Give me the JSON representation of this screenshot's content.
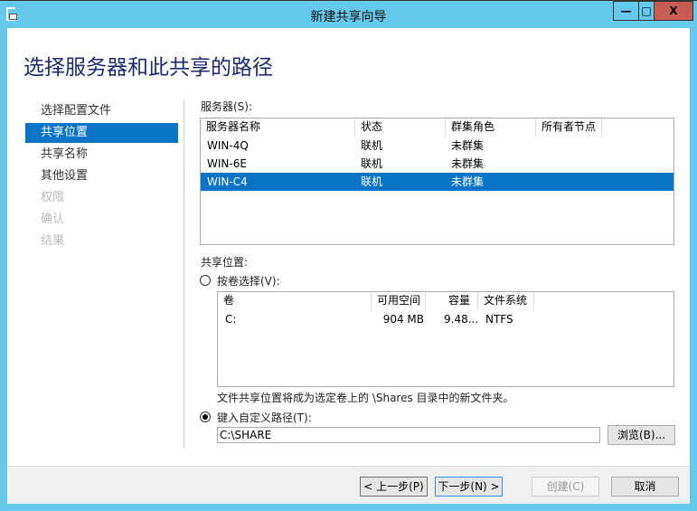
{
  "window": {
    "title": "新建共享向导",
    "minimize": "—",
    "maximize": "□",
    "close": "X"
  },
  "page_title": "选择服务器和此共享的路径",
  "nav": [
    {
      "label": "选择配置文件",
      "state": "normal"
    },
    {
      "label": "共享位置",
      "state": "selected"
    },
    {
      "label": "共享名称",
      "state": "normal"
    },
    {
      "label": "其他设置",
      "state": "normal"
    },
    {
      "label": "权限",
      "state": "disabled"
    },
    {
      "label": "确认",
      "state": "disabled"
    },
    {
      "label": "结果",
      "state": "disabled"
    }
  ],
  "servers": {
    "label": "服务器(S):",
    "columns": [
      "服务器名称",
      "状态",
      "群集角色",
      "所有者节点"
    ],
    "rows": [
      [
        "WIN-4Q",
        "联机",
        "未群集",
        ""
      ],
      [
        "WIN-6E",
        "联机",
        "未群集",
        ""
      ],
      [
        "WIN-C4",
        "联机",
        "未群集",
        ""
      ]
    ],
    "selected_index": 2
  },
  "share_location": {
    "label": "共享位置:",
    "by_volume": {
      "label": "按卷选择(V):",
      "selected": false
    },
    "volumes": {
      "columns": [
        "卷",
        "可用空间",
        "容量",
        "文件系统"
      ],
      "rows": [
        [
          "C:",
          "904 MB",
          "9.48...",
          "NTFS"
        ]
      ]
    },
    "note": "文件共享位置将成为选定卷上的 \\Shares 目录中的新文件夹。",
    "custom": {
      "label": "键入自定义路径(T):",
      "selected": true,
      "value": "C:\\SHARE"
    },
    "browse": "浏览(B)..."
  },
  "footer": {
    "prev": "< 上一步(P)",
    "next": "下一步(N) >",
    "create": "创建(C)",
    "cancel": "取消"
  }
}
